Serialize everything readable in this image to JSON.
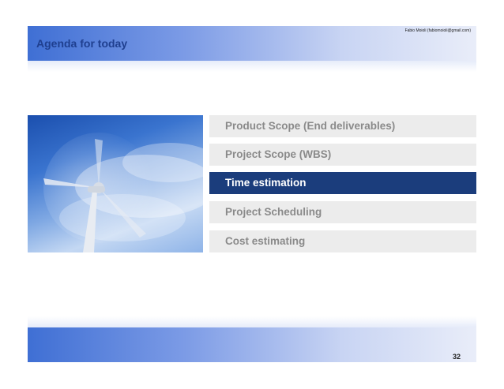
{
  "header": {
    "author": "Fabio Moioli (fabiomoioli@gmail.com)",
    "title": "Agenda for today"
  },
  "agenda": {
    "items": [
      {
        "label": "Product Scope (End deliverables)",
        "active": false
      },
      {
        "label": "Project Scope (WBS)",
        "active": false
      },
      {
        "label": "Time estimation",
        "active": true
      },
      {
        "label": "Project Scheduling",
        "active": false
      },
      {
        "label": "Cost estimating",
        "active": false
      }
    ]
  },
  "footer": {
    "page_number": "32"
  },
  "colors": {
    "band_start": "#3f6fd4",
    "title": "#1f3f8f",
    "active_item": "#1b3d7c",
    "inactive_item_bg": "#ececec",
    "inactive_item_text": "#8a8a8a"
  }
}
